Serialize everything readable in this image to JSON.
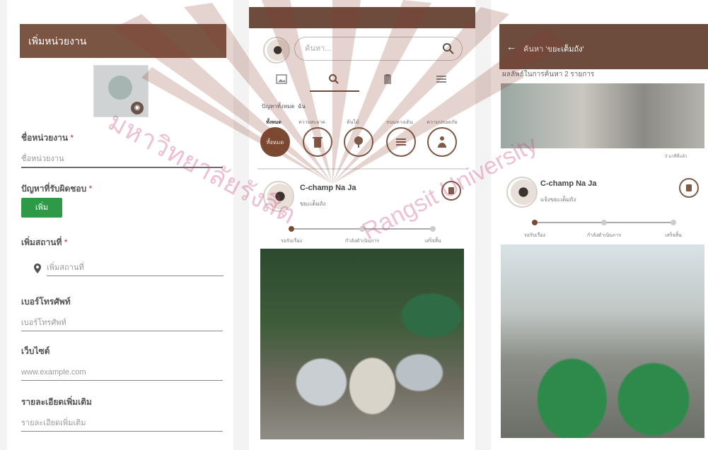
{
  "panel1": {
    "header_title": "เพิ่มหน่วยงาน",
    "camera_icon": "camera-icon",
    "fields": [
      {
        "label": "ชื่อหน่วยงาน",
        "required": "*",
        "placeholder": "ชื่อหน่วยงาน"
      },
      {
        "label": "ปัญหาที่รับผิดชอบ",
        "required": "*",
        "button": "เพิ่ม"
      },
      {
        "label": "เพิ่มสถานที่",
        "required": "*",
        "placeholder": "เพิ่มสถานที่"
      },
      {
        "label": "เบอร์โทรศัพท์",
        "required": "",
        "placeholder": "เบอร์โทรศัพท์"
      },
      {
        "label": "เว็บไซต์",
        "required": "",
        "placeholder": "www.example.com"
      },
      {
        "label": "รายละเอียดเพิ่มเติม",
        "required": "",
        "placeholder": "รายละเอียดเพิ่มเติม"
      }
    ]
  },
  "panel2": {
    "search_placeholder": "ค้นหา...",
    "categories_heading": "ปัญหาทั้งหมด",
    "categories_sub": "ฉัน",
    "categories": [
      {
        "label": "ทั้งหมด",
        "selected": true,
        "icon": "all"
      },
      {
        "label": "ความสะอาด",
        "selected": false,
        "icon": "trash-bin-icon"
      },
      {
        "label": "ต้นไม้",
        "selected": false,
        "icon": "tree-icon"
      },
      {
        "label": "ถนนทางเดิน",
        "selected": false,
        "icon": "road-icon"
      },
      {
        "label": "ความปลอดภัย",
        "selected": false,
        "icon": "person-icon"
      }
    ],
    "post": {
      "user": "C-champ Na Ja",
      "category": "ขยะเต็มถัง",
      "progress_labels": [
        "รอรับเรื่อง",
        "กำลังดำเนินการ",
        "เสร็จสิ้น"
      ]
    }
  },
  "panel3": {
    "header_title": "ค้นหา 'ขยะเต็มถัง'",
    "result_count": "ผลลัพธ์ในการค้นหา 2 รายการ",
    "time_label": "3 นาทีที่แล้ว",
    "post": {
      "user": "C-champ Na Ja",
      "category": "แจ้งขยะเต็มถัง",
      "progress_labels": [
        "รอรับเรื่อง",
        "กำลังดำเนินการ",
        "เสร็จสิ้น"
      ]
    }
  },
  "watermark": {
    "thai": "มหาวิทยาลัยรังสิต",
    "english": "Rangsit University"
  },
  "colors": {
    "brand_brown": "#7b5544",
    "dark_brown": "#6d4c3e",
    "green_button": "#2e9a48"
  }
}
